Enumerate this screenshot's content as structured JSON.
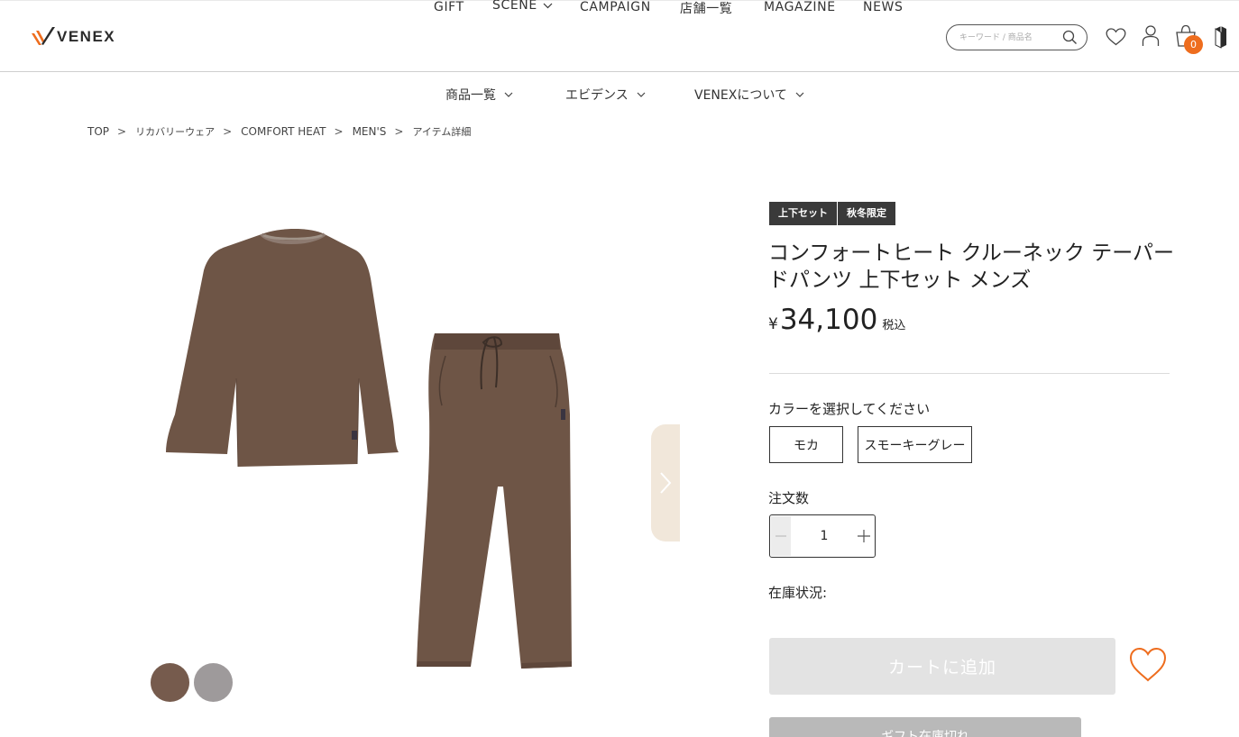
{
  "brand": {
    "name": "VENEX"
  },
  "header": {
    "nav": [
      {
        "label": "GIFT"
      },
      {
        "label": "SCENE"
      },
      {
        "label": "CAMPAIGN"
      },
      {
        "label": "店舗一覧"
      },
      {
        "label": "MAGAZINE"
      },
      {
        "label": "NEWS"
      }
    ],
    "search": {
      "placeholder": "キーワード / 商品名"
    },
    "cart_count": "0",
    "icons": [
      "search-icon",
      "heart-icon",
      "user-icon",
      "cart-icon",
      "brand-icon"
    ]
  },
  "subnav": [
    {
      "label": "商品一覧"
    },
    {
      "label": "エビデンス"
    },
    {
      "label": "VENEXについて"
    }
  ],
  "breadcrumb": [
    "TOP",
    "リカバリーウェア",
    "COMFORT HEAT",
    "MEN'S",
    "アイテム詳細"
  ],
  "product": {
    "tags": [
      "上下セット",
      "秋冬限定"
    ],
    "title": "コンフォートヒート クルーネック テーパードパンツ 上下セット メンズ",
    "price_symbol": "¥",
    "price": "34,100",
    "tax_label": "税込",
    "color_label": "カラーを選択してください",
    "colors": [
      {
        "label": "モカ",
        "hex": "#765b4d"
      },
      {
        "label": "スモーキーグレー",
        "hex": "#9e9a9b"
      }
    ],
    "qty_label": "注文数",
    "qty_value": "1",
    "stock_label": "在庫状況:",
    "add_to_cart": "カートに追加",
    "gift_button": "ギフト在庫切れ",
    "accent": "#ee6d1e",
    "garment_color": "#6e5546"
  }
}
